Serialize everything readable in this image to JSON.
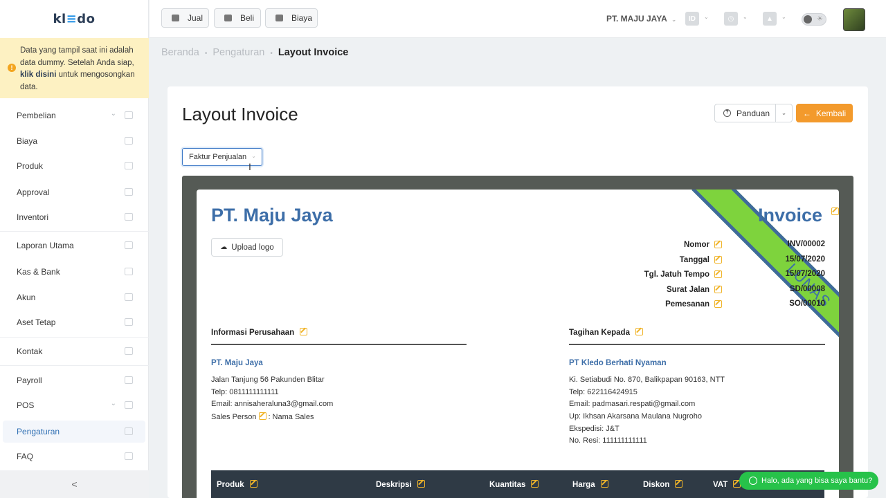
{
  "app": {
    "logo": "kledo"
  },
  "notice": {
    "text_before": "Data yang tampil saat ini adalah data dummy. Setelah Anda siap, ",
    "link": "klik disini",
    "text_after": " untuk mengosongkan data."
  },
  "sidebar": {
    "items": [
      {
        "label": "Pembelian",
        "icon": "bag-icon",
        "has_chevron": true
      },
      {
        "label": "Biaya",
        "icon": "card-icon"
      },
      {
        "label": "Produk",
        "icon": "box-icon"
      },
      {
        "label": "Approval",
        "icon": "check-icon"
      },
      {
        "label": "Inventori",
        "icon": "briefcase-icon"
      },
      {
        "label": "Laporan Utama",
        "icon": "chart-icon"
      },
      {
        "label": "Kas & Bank",
        "icon": "dollar-icon"
      },
      {
        "label": "Akun",
        "icon": "account-icon"
      },
      {
        "label": "Aset Tetap",
        "icon": "building-icon"
      },
      {
        "label": "Kontak",
        "icon": "contact-icon"
      },
      {
        "label": "Payroll",
        "icon": "payroll-icon"
      },
      {
        "label": "POS",
        "icon": "pos-icon",
        "has_chevron": true
      },
      {
        "label": "Pengaturan",
        "icon": "gear-icon",
        "active": true
      },
      {
        "label": "FAQ",
        "icon": "question-icon"
      }
    ],
    "collapse": "<"
  },
  "topbar": {
    "buttons": [
      "Jual",
      "Beli",
      "Biaya"
    ],
    "company": "PT. MAJU JAYA",
    "lang": "ID"
  },
  "breadcrumb": {
    "home": "Beranda",
    "parent": "Pengaturan",
    "current": "Layout Invoice"
  },
  "page": {
    "title": "Layout Invoice",
    "panduan": "Panduan",
    "kembali": "Kembali",
    "select_value": "Faktur Penjualan"
  },
  "invoice": {
    "company": "PT. Maju Jaya",
    "upload": "Upload logo",
    "title": "Invoice",
    "stamp": "LUNAS",
    "meta": [
      {
        "label": "Nomor",
        "value": "INV/00002"
      },
      {
        "label": "Tanggal",
        "value": "15/07/2020"
      },
      {
        "label": "Tgl. Jatuh Tempo",
        "value": "15/07/2020"
      },
      {
        "label": "Surat Jalan",
        "value": "SD/00008"
      },
      {
        "label": "Pemesanan",
        "value": "SO/00010"
      }
    ],
    "seller": {
      "heading": "Informasi Perusahaan",
      "name": "PT. Maju Jaya",
      "lines": [
        "Jalan Tanjung 56 Pakunden Blitar",
        "Telp: 0811111111111",
        "Email: annisaheraluna3@gmail.com"
      ],
      "sales_label": "Sales Person",
      "sales_value": ": Nama Sales"
    },
    "buyer": {
      "heading": "Tagihan Kepada",
      "name": "PT Kledo Berhati Nyaman",
      "lines": [
        "Ki. Setiabudi No. 870, Balikpapan 90163, NTT",
        "Telp: 622116424915",
        "Email: padmasari.respati@gmail.com",
        "Up: Ikhsan Akarsana Maulana Nugroho",
        "Ekspedisi: J&T",
        "No. Resi: 111111111111"
      ]
    },
    "columns": [
      "Produk",
      "Deskripsi",
      "Kuantitas",
      "Harga",
      "Diskon",
      "VAT"
    ]
  },
  "chat": {
    "label": "Halo, ada yang bisa saya bantu?"
  },
  "colors": {
    "accent": "#3d6ea8",
    "orange": "#f39a2c",
    "green": "#27c24a"
  }
}
